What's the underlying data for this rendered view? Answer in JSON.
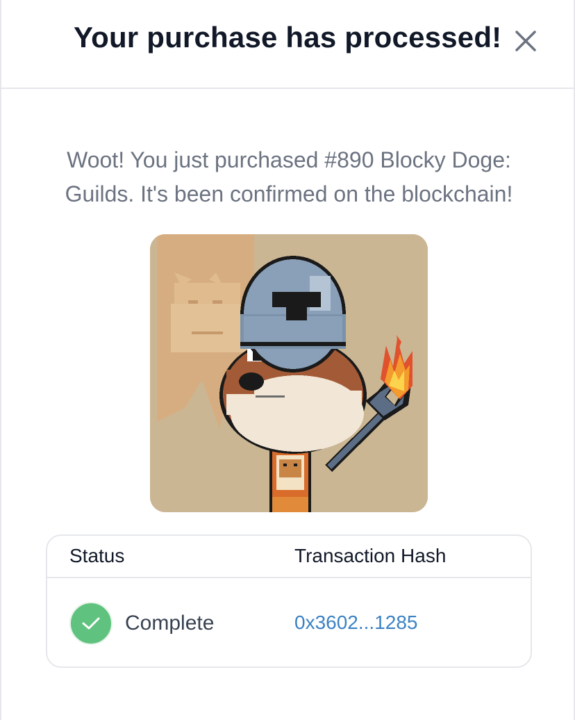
{
  "modal": {
    "title": "Your purchase has processed!",
    "close_icon": "close-icon"
  },
  "message": "Woot! You just purchased #890 Blocky Doge: Guilds. It's been confirmed on the blockchain!",
  "nft": {
    "image": "pixel-art doge wearing a knight helmet holding a flaming trident"
  },
  "transaction": {
    "headers": {
      "status": "Status",
      "hash": "Transaction Hash"
    },
    "status_value": "Complete",
    "status_icon": "check-circle-icon",
    "hash_value": "0x3602...1285"
  },
  "colors": {
    "success": "#5fc27e",
    "link": "#3b82c4",
    "title": "#111827",
    "muted_text": "#6b7280",
    "border": "#e5e7eb"
  }
}
